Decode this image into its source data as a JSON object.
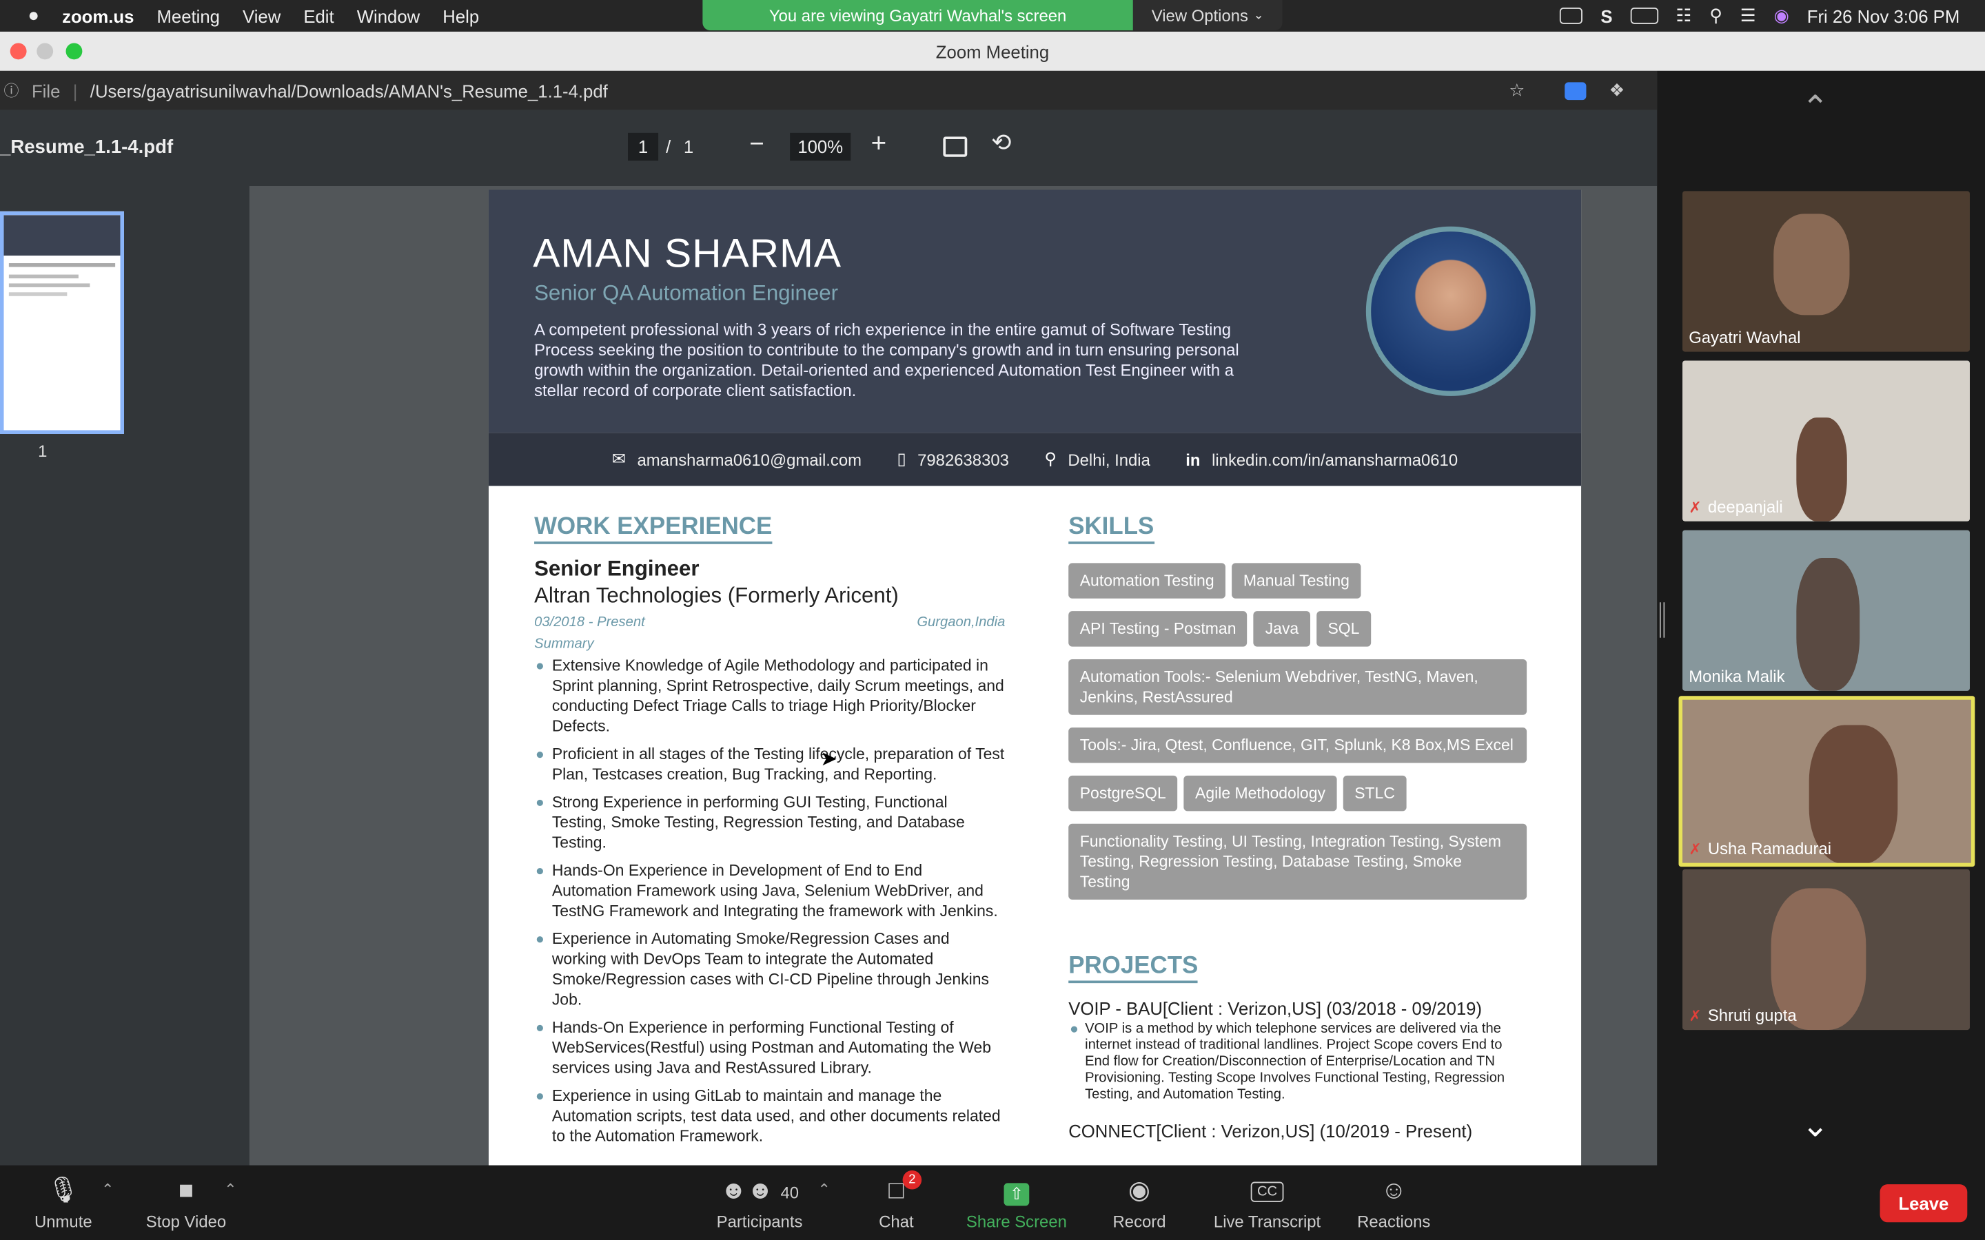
{
  "menubar": {
    "app": "zoom.us",
    "items": [
      "Meeting",
      "View",
      "Edit",
      "Window",
      "Help"
    ],
    "banner": "You are viewing Gayatri Wavhal's screen",
    "view_options": "View Options",
    "clock": "Fri 26 Nov  3:06 PM"
  },
  "window": {
    "title": "Zoom Meeting"
  },
  "browser": {
    "file_label": "File",
    "path": "/Users/gayatrisunilwavhal/Downloads/AMAN's_Resume_1.1-4.pdf"
  },
  "pdf": {
    "filename": "_Resume_1.1-4.pdf",
    "page_current": "1",
    "page_total": "1",
    "zoom": "100%",
    "thumb_number": "1"
  },
  "resume": {
    "name": "AMAN SHARMA",
    "role": "Senior QA Automation Engineer",
    "summary": "A competent professional with 3 years of rich experience in the entire gamut of Software Testing Process seeking the position to contribute to the company's growth and in turn ensuring personal growth within the organization. Detail-oriented and experienced Automation Test Engineer with a stellar record of corporate client satisfaction.",
    "email": "amansharma0610@gmail.com",
    "phone": "7982638303",
    "location": "Delhi, India",
    "linkedin": "linkedin.com/in/amansharma0610",
    "work_heading": "WORK EXPERIENCE",
    "job_title": "Senior Engineer",
    "company": "Altran Technologies (Formerly Aricent)",
    "dates": "03/2018 - Present",
    "job_location": "Gurgaon,India",
    "summary_label": "Summary",
    "bullets": [
      "Extensive Knowledge of Agile Methodology and participated in Sprint planning, Sprint Retrospective, daily Scrum meetings, and conducting Defect Triage Calls to triage High Priority/Blocker Defects.",
      "Proficient in all stages of the Testing lifecycle, preparation of Test Plan, Testcases creation, Bug Tracking, and Reporting.",
      "Strong Experience in performing GUI Testing, Functional Testing, Smoke Testing, Regression Testing, and Database Testing.",
      "Hands-On Experience in Development of End to End Automation Framework using Java, Selenium WebDriver, and TestNG Framework and Integrating the framework with Jenkins.",
      "Experience in Automating Smoke/Regression Cases and working with DevOps Team to integrate the Automated Smoke/Regression cases with CI-CD Pipeline through Jenkins Job.",
      "Hands-On Experience in performing Functional Testing of WebServices(Restful) using Postman and Automating the Web services using Java and RestAssured Library.",
      "Experience in using GitLab to maintain and manage the Automation scripts, test data used, and other documents related to the Automation Framework."
    ],
    "skills_heading": "SKILLS",
    "skills": [
      [
        "Automation Testing",
        "Manual Testing"
      ],
      [
        "API Testing - Postman",
        "Java",
        "SQL"
      ],
      [
        "Automation Tools:- Selenium Webdriver, TestNG, Maven, Jenkins, RestAssured"
      ],
      [
        "Tools:- Jira, Qtest, Confluence, GIT, Splunk, K8 Box,MS Excel"
      ],
      [
        "PostgreSQL",
        "Agile Methodology",
        "STLC"
      ],
      [
        "Functionality Testing, UI Testing, Integration Testing, System Testing, Regression Testing, Database Testing, Smoke Testing"
      ]
    ],
    "projects_heading": "PROJECTS",
    "project1_title": "VOIP - BAU[Client : Verizon,US] (03/2018 - 09/2019)",
    "project1_desc": "VOIP is a method by which telephone services are delivered via the internet instead of traditional landlines. Project Scope covers End to End flow for Creation/Disconnection of Enterprise/Location and TN Provisioning. Testing Scope Involves Functional Testing, Regression Testing, and Automation Testing.",
    "project2_title": "CONNECT[Client : Verizon,US] (10/2019 - Present)"
  },
  "participants": [
    {
      "name": "Gayatri Wavhal",
      "muted": false,
      "active": false,
      "bg": "#5a4a3a"
    },
    {
      "name": "deepanjali",
      "muted": true,
      "active": false,
      "bg": "#d9d4cc"
    },
    {
      "name": "Monika Malik",
      "muted": false,
      "active": false,
      "bg": "#8a9aa0"
    },
    {
      "name": "Usha Ramadurai",
      "muted": true,
      "active": true,
      "bg": "#a89280"
    },
    {
      "name": "Shruti gupta",
      "muted": true,
      "active": false,
      "bg": "#5a4e46"
    }
  ],
  "toolbar": {
    "unmute": "Unmute",
    "stop_video": "Stop Video",
    "participants": "Participants",
    "participants_count": "40",
    "chat": "Chat",
    "chat_badge": "2",
    "share": "Share Screen",
    "record": "Record",
    "transcript": "Live Transcript",
    "reactions": "Reactions",
    "leave": "Leave"
  },
  "colors": {
    "accent_green": "#43b05c",
    "leave_red": "#e02828",
    "active_speaker": "#e6e05a",
    "section_teal": "#6a98a8"
  }
}
